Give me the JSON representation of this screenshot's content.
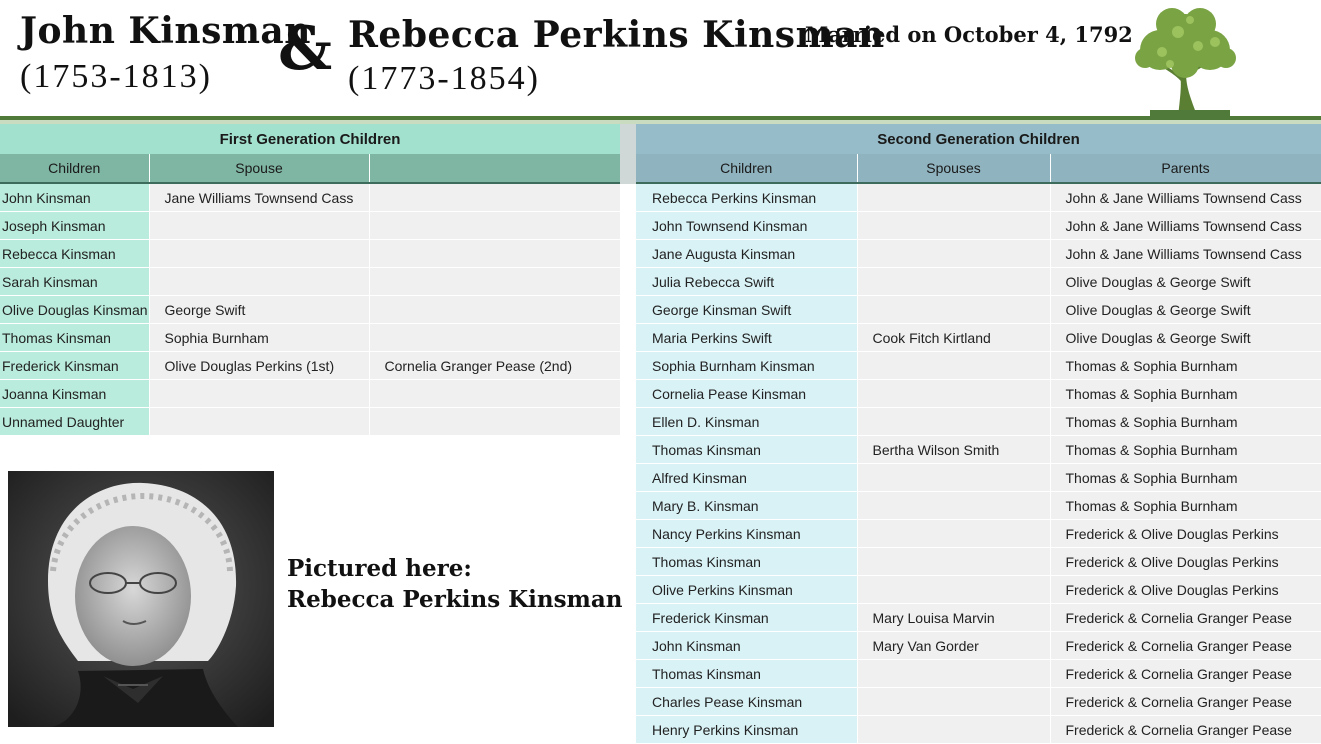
{
  "header": {
    "husband_name": "John Kinsman",
    "husband_dates": "(1753-1813)",
    "ampersand": "&",
    "wife_name": "Rebecca Perkins Kinsman",
    "wife_dates": "(1773-1854)",
    "married": "Married on October 4, 1792"
  },
  "first_generation": {
    "title": "First Generation Children",
    "columns": [
      "Children",
      "Spouse",
      ""
    ],
    "rows": [
      [
        "John Kinsman",
        "Jane Williams Townsend Cass",
        ""
      ],
      [
        "Joseph Kinsman",
        "",
        ""
      ],
      [
        "Rebecca Kinsman",
        "",
        ""
      ],
      [
        "Sarah Kinsman",
        "",
        ""
      ],
      [
        "Olive Douglas Kinsman",
        "George Swift",
        ""
      ],
      [
        "Thomas Kinsman",
        "Sophia Burnham",
        ""
      ],
      [
        "Frederick Kinsman",
        "Olive Douglas Perkins (1st)",
        "Cornelia Granger Pease (2nd)"
      ],
      [
        "Joanna Kinsman",
        "",
        ""
      ],
      [
        "Unnamed Daughter",
        "",
        ""
      ]
    ]
  },
  "second_generation": {
    "title": "Second Generation Children",
    "columns": [
      "Children",
      "Spouses",
      "Parents"
    ],
    "rows": [
      [
        "Rebecca Perkins Kinsman",
        "",
        "John & Jane Williams Townsend Cass"
      ],
      [
        "John Townsend Kinsman",
        "",
        "John & Jane Williams Townsend Cass"
      ],
      [
        "Jane Augusta Kinsman",
        "",
        "John & Jane Williams Townsend Cass"
      ],
      [
        "Julia Rebecca Swift",
        "",
        "Olive Douglas & George Swift"
      ],
      [
        "George Kinsman Swift",
        "",
        "Olive Douglas & George Swift"
      ],
      [
        "Maria Perkins Swift",
        "Cook Fitch Kirtland",
        "Olive Douglas & George Swift"
      ],
      [
        "Sophia Burnham Kinsman",
        "",
        "Thomas & Sophia Burnham"
      ],
      [
        "Cornelia Pease Kinsman",
        "",
        "Thomas & Sophia Burnham"
      ],
      [
        "Ellen D. Kinsman",
        "",
        "Thomas & Sophia Burnham"
      ],
      [
        "Thomas Kinsman",
        "Bertha Wilson Smith",
        "Thomas & Sophia Burnham"
      ],
      [
        "Alfred Kinsman",
        "",
        "Thomas & Sophia Burnham"
      ],
      [
        "Mary B. Kinsman",
        "",
        "Thomas & Sophia Burnham"
      ],
      [
        "Nancy Perkins Kinsman",
        "",
        "Frederick & Olive Douglas Perkins"
      ],
      [
        "Thomas Kinsman",
        "",
        "Frederick & Olive Douglas Perkins"
      ],
      [
        "Olive Perkins Kinsman",
        "",
        "Frederick & Olive Douglas Perkins"
      ],
      [
        "Frederick Kinsman",
        "Mary Louisa Marvin",
        "Frederick & Cornelia Granger Pease"
      ],
      [
        "John Kinsman",
        "Mary Van Gorder",
        "Frederick & Cornelia Granger Pease"
      ],
      [
        "Thomas Kinsman",
        "",
        "Frederick & Cornelia Granger Pease"
      ],
      [
        "Charles Pease Kinsman",
        "",
        "Frederick & Cornelia Granger Pease"
      ],
      [
        "Henry Perkins Kinsman",
        "",
        "Frederick & Cornelia Granger Pease"
      ]
    ]
  },
  "caption": {
    "line1": "Pictured here:",
    "line2": "Rebecca Perkins Kinsman"
  },
  "colors": {
    "first_gen_header": "#a3e1cf",
    "second_gen_header": "#95bcc8",
    "tree_green": "#6f9a3c",
    "rule_green": "#4f7a3a"
  }
}
